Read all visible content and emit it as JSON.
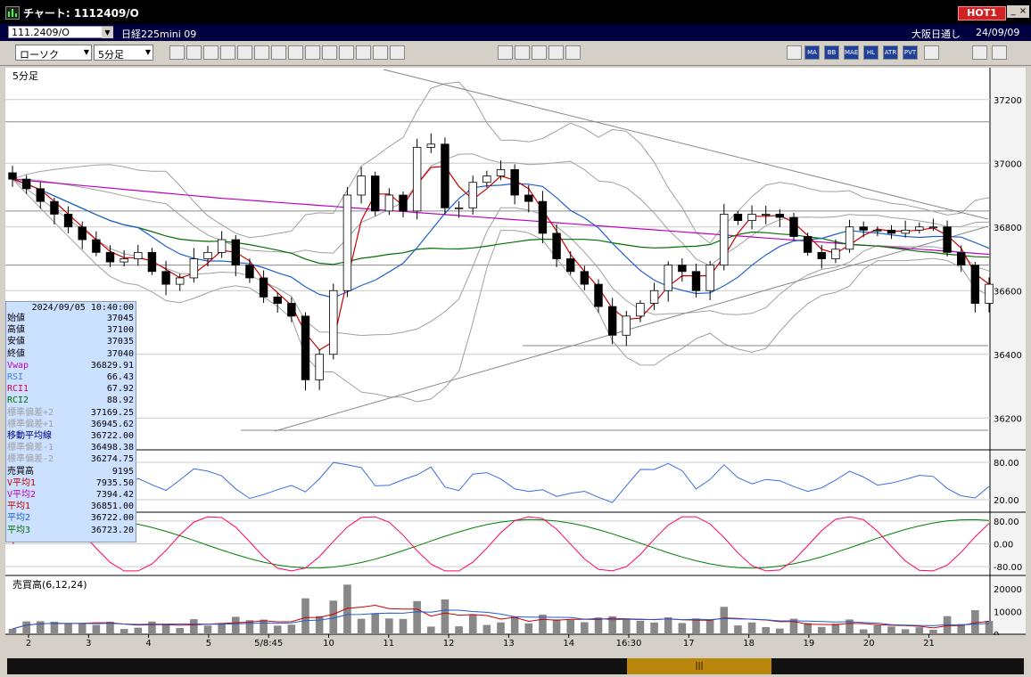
{
  "window": {
    "title": "チャート: 1112409/O",
    "hot_badge": "HOT1",
    "min": "_",
    "max": "□",
    "close": "×"
  },
  "infobar": {
    "code": "111.2409/O",
    "dropdown_arrow": "▼",
    "instrument": "日経225mini 09",
    "session": "大阪日通し",
    "date": "24/09/09"
  },
  "toolbar": {
    "chart_type": "ローソク",
    "timeframe": "5分足",
    "dropdown_arrow": "▼",
    "tools": [
      "search-icon",
      "crosshair-icon",
      "pen-icon",
      "hline-icon",
      "cursor-icon",
      "undo-icon",
      "memo-icon",
      "trash-icon",
      "grid-icon",
      "marker-icon",
      "all-button",
      "bars-icon",
      "brush-icon",
      "palette-icon"
    ],
    "tools2": [
      "hand-icon",
      "zoom-icon",
      "chart-icon",
      "balance-icon",
      "lock-icon"
    ],
    "right_buttons": [
      "MA",
      "BB",
      "MAE",
      "HL",
      "ATR",
      "PVT"
    ],
    "right_icons": [
      "table-icon",
      "window-icon",
      "log-icon",
      "export-icon"
    ],
    "button_colors": {
      "blue": "#1f3f99",
      "light": "#ececec"
    }
  },
  "colors": {
    "candle": "#000000",
    "vwap": "#c000c0",
    "ma_short": "#cc0000",
    "ma_mid": "#1f5fd0",
    "ma_long": "#007000",
    "band": "#a0a0a0",
    "rsi": "#3c6ee0",
    "rci1": "#ff0066",
    "rci2": "#008000",
    "volume": "#888888"
  },
  "chart": {
    "timeframe_label": "5分足",
    "volume_label": "売買高(6,12,24)",
    "price_axis": [
      "37200",
      "37000",
      "36800",
      "36600",
      "36400",
      "36200"
    ],
    "rsi_axis": [
      "80.00",
      "20.00"
    ],
    "rci_axis": [
      "80.00",
      "0.00",
      "-80.00"
    ],
    "vol_axis": [
      "20000",
      "10000",
      "0"
    ],
    "x_labels": [
      "2",
      "3",
      "4",
      "5",
      "5/8:45",
      "10",
      "11",
      "12",
      "13",
      "14",
      "16:30",
      "17",
      "18",
      "19",
      "20",
      "21"
    ]
  },
  "chart_data": {
    "type": "candlestick",
    "ylim": [
      36100,
      37300
    ],
    "grid": true,
    "closes": [
      36950,
      36920,
      36880,
      36840,
      36800,
      36760,
      36720,
      36690,
      36700,
      36720,
      36660,
      36620,
      36640,
      36700,
      36720,
      36760,
      36680,
      36640,
      36580,
      36560,
      36520,
      36320,
      36400,
      36600,
      36900,
      36960,
      36850,
      36900,
      36850,
      37050,
      37060,
      36860,
      36860,
      36940,
      36960,
      36980,
      36900,
      36880,
      36780,
      36700,
      36660,
      36620,
      36550,
      36460,
      36520,
      36560,
      36600,
      36680,
      36660,
      36600,
      36680,
      36840,
      36820,
      36840,
      36840,
      36830,
      36770,
      36720,
      36700,
      36730,
      36800,
      36790,
      36790,
      36780,
      36790,
      36800,
      36800,
      36720,
      36680,
      36560,
      36620
    ]
  },
  "datapanel": {
    "date": "2024/09/05 10:40:00",
    "rows": [
      {
        "label": "始値",
        "value": "37045",
        "color": "#000000"
      },
      {
        "label": "高値",
        "value": "37100",
        "color": "#000000"
      },
      {
        "label": "安値",
        "value": "37035",
        "color": "#000000"
      },
      {
        "label": "終値",
        "value": "37040",
        "color": "#000000"
      },
      {
        "label": "Vwap",
        "value": "36829.91",
        "color": "#c000c0"
      },
      {
        "label": "RSI",
        "value": "66.43",
        "color": "#4a7ee8"
      },
      {
        "label": "RCI1",
        "value": "67.92",
        "color": "#d00050"
      },
      {
        "label": "RCI2",
        "value": "88.92",
        "color": "#007000"
      },
      {
        "label": "標準偏差+2",
        "value": "37169.25",
        "color": "#a0a0a0"
      },
      {
        "label": "標準偏差+1",
        "value": "36945.62",
        "color": "#a0a0a0"
      },
      {
        "label": "移動平均線",
        "value": "36722.00",
        "color": "#000080"
      },
      {
        "label": "標準偏差-1",
        "value": "36498.38",
        "color": "#a0a0a0"
      },
      {
        "label": "標準偏差-2",
        "value": "36274.75",
        "color": "#a0a0a0"
      },
      {
        "label": "売買高",
        "value": "9195",
        "color": "#000000"
      },
      {
        "label": "V平均1",
        "value": "7935.50",
        "color": "#c00000"
      },
      {
        "label": "V平均2",
        "value": "7394.42",
        "color": "#c000c0"
      },
      {
        "label": "平均1",
        "value": "36851.00",
        "color": "#c00000"
      },
      {
        "label": "平均2",
        "value": "36722.00",
        "color": "#1f5fd0"
      },
      {
        "label": "平均3",
        "value": "36723.20",
        "color": "#007000"
      }
    ]
  },
  "scrollbar": {
    "grip": "|||"
  }
}
